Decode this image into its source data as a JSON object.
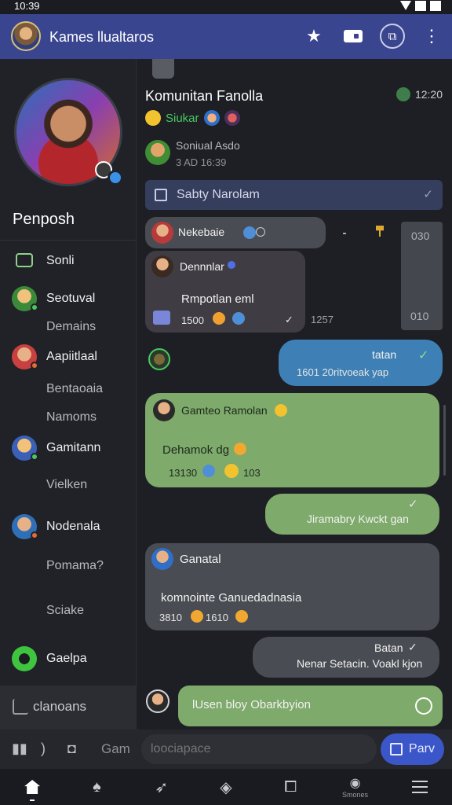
{
  "status": {
    "time": "10:39"
  },
  "app": {
    "title": "Kames llualtaros"
  },
  "colors": {
    "header": "#3a4590",
    "accent": "#3b56c8",
    "green_bubble": "#7eaa6b",
    "blue_bubble": "#3e80b5",
    "online": "#49c861"
  },
  "sidebar": {
    "profile_name": "Penposh",
    "items": [
      {
        "label": "Sonli",
        "icon": "chart-trend-icon"
      },
      {
        "label": "Seotuval",
        "icon": "avatar-green"
      },
      {
        "label": "Demains",
        "icon": ""
      },
      {
        "label": "Aapiitlaal",
        "icon": "avatar-red"
      },
      {
        "label": "Bentaoaia",
        "icon": ""
      },
      {
        "label": "Namoms",
        "icon": ""
      },
      {
        "label": "Gamitann",
        "icon": "avatar-yellow"
      },
      {
        "label": "Vielken",
        "icon": ""
      },
      {
        "label": "Nodenala",
        "icon": "avatar-blue"
      },
      {
        "label": "Pomama?",
        "icon": ""
      },
      {
        "label": "Sciake",
        "icon": ""
      },
      {
        "label": "Gaelpa",
        "icon": "green-game-icon"
      }
    ],
    "footer_label": "clanoans"
  },
  "chat": {
    "title": "Komunitan Fanolla",
    "time": "12:20",
    "sub_label": "Siukar",
    "member_name": "Soniual Asdo",
    "member_meta": "3 AD 16:39",
    "pinned": "Sabty Narolam",
    "side_panel": {
      "top": "030",
      "bottom": "010"
    },
    "messages": [
      {
        "author": "Nekebaie",
        "text": ""
      },
      {
        "author": "Dennnlar",
        "text": "Rmpotlan eml",
        "meta": "1500",
        "time": "1257"
      },
      {
        "text": "tatan",
        "meta": "1601 20ritvoeak yap"
      },
      {
        "author": "Gamteo Ramolan",
        "text": "Dehamok dg",
        "meta": "13130",
        "count": "103"
      },
      {
        "text": "Jiramabry Kwckt gan"
      },
      {
        "author": "Ganatal",
        "text": "komnointe Ganuedadnasia",
        "meta": "3810",
        "meta2": "1610"
      },
      {
        "text": "Batan",
        "meta": "Nenar Setacin. Voakl kjon"
      },
      {
        "text": "lUsen bloy Obarkbyion"
      }
    ]
  },
  "composer": {
    "game_label": "Gam",
    "placeholder": "loociapace",
    "send_label": "Parv"
  },
  "bottom_nav": {
    "items": [
      "home",
      "tree",
      "explore",
      "stats",
      "share",
      "Smones",
      "menu"
    ],
    "labeled": "Smones"
  }
}
